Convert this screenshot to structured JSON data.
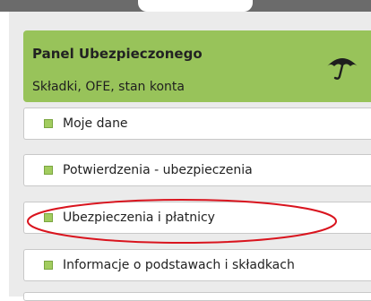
{
  "panel": {
    "title": "Panel Ubezpieczonego",
    "subtitle": "Składki, OFE, stan konta",
    "icon": "umbrella-icon"
  },
  "menu": {
    "items": [
      {
        "label": "Moje dane"
      },
      {
        "label": "Potwierdzenia - ubezpieczenia"
      },
      {
        "label": "Ubezpieczenia i płatnicy"
      },
      {
        "label": "Informacje o podstawach i składkach"
      }
    ]
  },
  "colors": {
    "header_green": "#98c35a",
    "bullet_green": "#a2cc5f",
    "highlight_red": "#d9141e",
    "background": "#ebebeb"
  }
}
